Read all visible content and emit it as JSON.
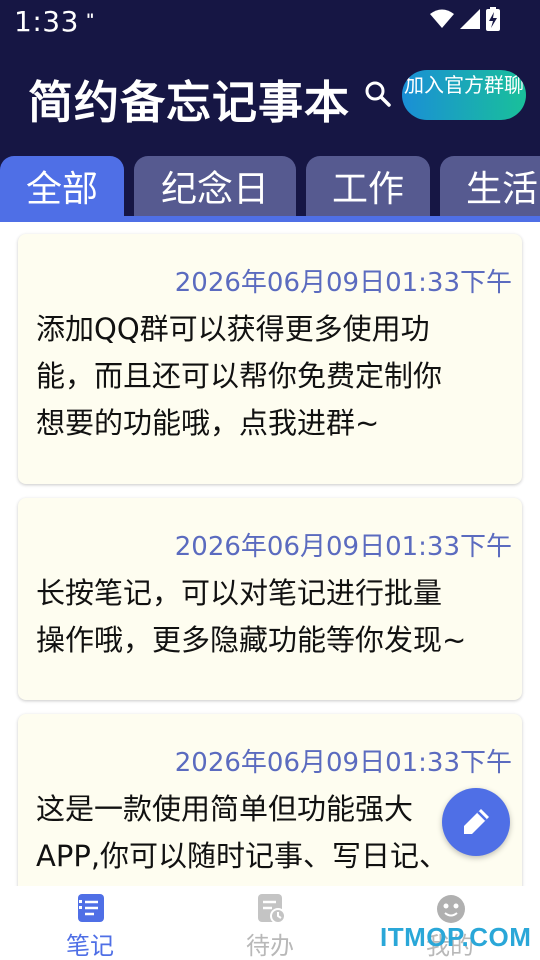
{
  "status_bar": {
    "time": "1:33",
    "notification_glyph": "\"",
    "icons": [
      "wifi-icon",
      "signal-icon",
      "battery-icon"
    ]
  },
  "header": {
    "title": "简约备忘记事本",
    "search_icon": "search-icon",
    "join_button_label": "加入官方群聊"
  },
  "tabs": [
    {
      "label": "全部",
      "active": true
    },
    {
      "label": "纪念日",
      "active": false
    },
    {
      "label": "工作",
      "active": false
    },
    {
      "label": "生活",
      "active": false
    }
  ],
  "notes": [
    {
      "date": "2026年06月09日01:33下午",
      "lines": [
        "添加QQ群可以获得更多使用功",
        "能，而且还可以帮你免费定制你",
        "想要的功能哦，点我进群~"
      ]
    },
    {
      "date": "2026年06月09日01:33下午",
      "lines": [
        "长按笔记，可以对笔记进行批量",
        "操作哦，更多隐藏功能等你发现~"
      ]
    },
    {
      "date": "2026年06月09日01:33下午",
      "lines": [
        "这是一款使用简单但功能强大",
        "APP,你可以随时记事、写日记、"
      ]
    }
  ],
  "fab_icon": "edit-icon",
  "bottom_nav": [
    {
      "label": "笔记",
      "icon": "notes-icon",
      "active": true
    },
    {
      "label": "待办",
      "icon": "todo-icon",
      "active": false
    },
    {
      "label": "我的",
      "icon": "profile-icon",
      "active": false
    }
  ],
  "watermark": "ITMOP.COM",
  "colors": {
    "header_bg": "#161644",
    "accent": "#4f6fe6",
    "tab_inactive": "#565a90",
    "card_bg": "#fefdf0",
    "date_text": "#5b6bbf",
    "join_gradient_start": "#1a8fd6",
    "join_gradient_end": "#19c09a"
  }
}
